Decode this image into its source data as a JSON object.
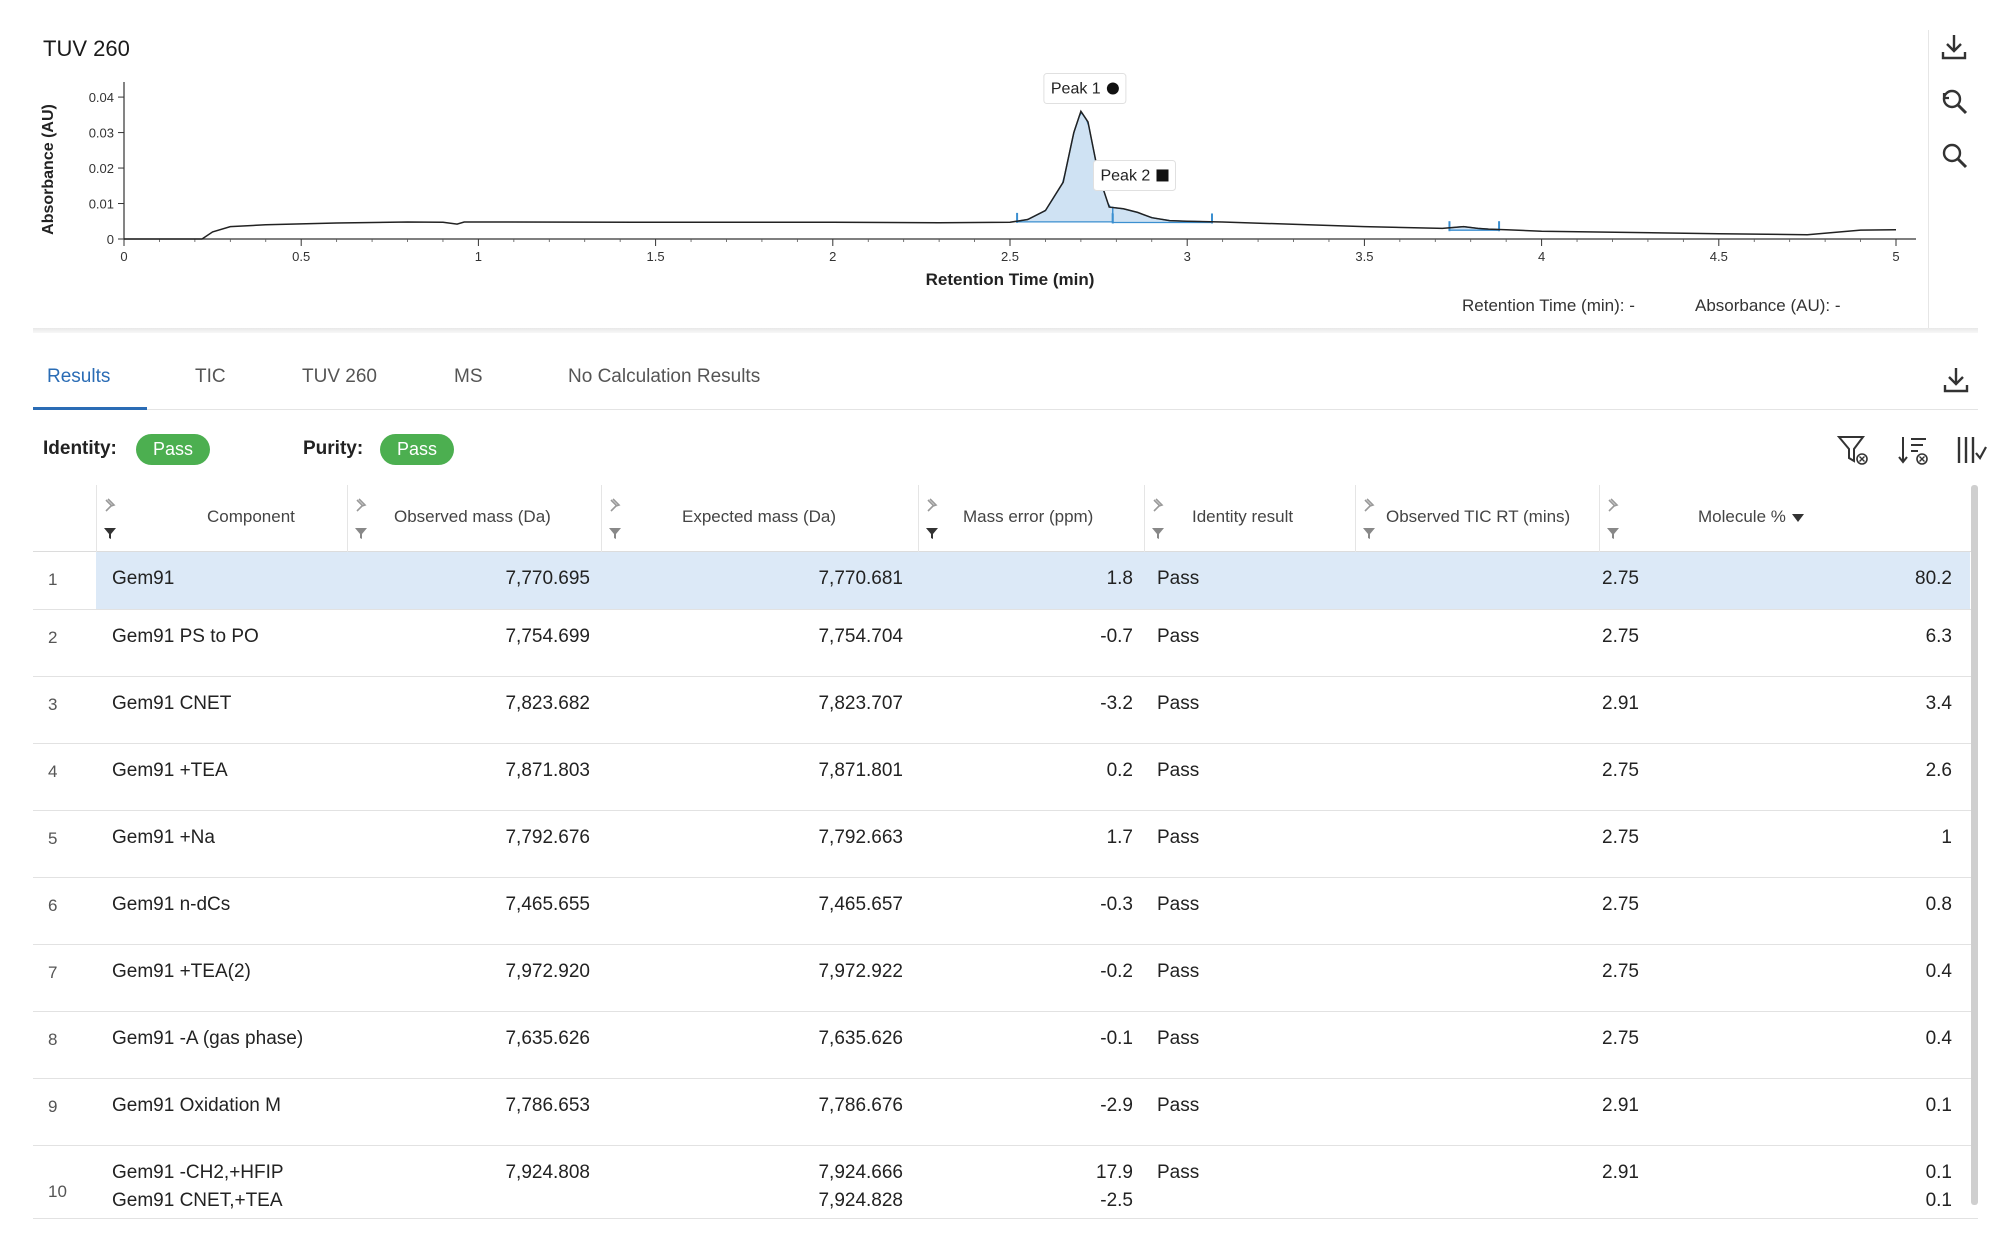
{
  "chart": {
    "title": "TUV 260",
    "readout": {
      "rt_label": "Retention Time (min):",
      "rt_value": "-",
      "abs_label": "Absorbance (AU):",
      "abs_value": "-"
    },
    "tools": [
      {
        "name": "download-icon"
      },
      {
        "name": "zoom-reset-icon"
      },
      {
        "name": "zoom-icon"
      }
    ]
  },
  "chart_data": {
    "type": "line",
    "title": "TUV 260",
    "xlabel": "Retention Time (min)",
    "ylabel": "Absorbance (AU)",
    "xlim": [
      0,
      5
    ],
    "ylim": [
      0,
      0.042
    ],
    "x_ticks": [
      0,
      0.5,
      1,
      1.5,
      2,
      2.5,
      3,
      3.5,
      4,
      4.5,
      5
    ],
    "x_tick_labels": [
      "0",
      "0.5",
      "1",
      "1.5",
      "2",
      "2.5",
      "3",
      "3.5",
      "4",
      "4.5",
      "5"
    ],
    "y_ticks": [
      0,
      0.01,
      0.02,
      0.03,
      0.04
    ],
    "y_tick_labels": [
      "0",
      "0.01",
      "0.02",
      "0.03",
      "0.04"
    ],
    "grid": false,
    "series": [
      {
        "x": [
          0,
          0.22,
          0.25,
          0.3,
          0.4,
          0.6,
          0.8,
          0.9,
          0.94,
          0.96,
          1.0,
          1.5,
          2.0,
          2.3,
          2.5,
          2.55,
          2.6,
          2.65,
          2.68,
          2.7,
          2.72,
          2.75,
          2.78,
          2.82,
          2.86,
          2.9,
          2.95,
          3.0,
          3.1,
          3.5,
          3.72,
          3.78,
          3.82,
          3.85,
          3.9,
          4.0,
          4.5,
          4.75,
          4.9,
          5.0
        ],
        "y": [
          0,
          0,
          0.002,
          0.0035,
          0.004,
          0.0045,
          0.0048,
          0.0047,
          0.0042,
          0.0048,
          0.0048,
          0.0047,
          0.0047,
          0.0046,
          0.0047,
          0.0055,
          0.008,
          0.016,
          0.03,
          0.036,
          0.033,
          0.018,
          0.009,
          0.0085,
          0.0075,
          0.006,
          0.0052,
          0.005,
          0.0048,
          0.0035,
          0.003,
          0.0035,
          0.003,
          0.0028,
          0.0026,
          0.0022,
          0.0015,
          0.0012,
          0.0025,
          0.0026
        ]
      }
    ],
    "peaks": [
      {
        "label": "Peak 1",
        "marker": "circle",
        "x": 2.7,
        "y": 0.036,
        "start": 2.52,
        "end": 2.79
      },
      {
        "label": "Peak 2",
        "marker": "square",
        "x": 2.83,
        "y": 0.0085,
        "start": 2.79,
        "end": 3.07
      },
      {
        "label": "",
        "marker": "",
        "x": 3.81,
        "y": 0.003,
        "start": 3.74,
        "end": 3.88
      }
    ]
  },
  "tabs": [
    {
      "label": "Results",
      "active": true
    },
    {
      "label": "TIC",
      "active": false
    },
    {
      "label": "TUV 260",
      "active": false
    },
    {
      "label": "MS",
      "active": false
    },
    {
      "label": "No Calculation Results",
      "active": false
    }
  ],
  "summary": {
    "identity_label": "Identity:",
    "identity_value": "Pass",
    "purity_label": "Purity:",
    "purity_value": "Pass"
  },
  "table": {
    "columns": [
      "Component",
      "Observed mass (Da)",
      "Expected mass (Da)",
      "Mass error (ppm)",
      "Identity result",
      "Observed TIC RT (mins)",
      "Molecule %"
    ],
    "sorted_column": "Molecule %",
    "rows": [
      {
        "n": "1",
        "component": [
          "Gem91"
        ],
        "observed": "7,770.695",
        "expected": [
          "7,770.681"
        ],
        "error": [
          "1.8"
        ],
        "identity": "Pass",
        "rt": "2.75",
        "molecule": [
          "80.2"
        ]
      },
      {
        "n": "2",
        "component": [
          "Gem91 PS to PO"
        ],
        "observed": "7,754.699",
        "expected": [
          "7,754.704"
        ],
        "error": [
          "-0.7"
        ],
        "identity": "Pass",
        "rt": "2.75",
        "molecule": [
          "6.3"
        ]
      },
      {
        "n": "3",
        "component": [
          "Gem91 CNET"
        ],
        "observed": "7,823.682",
        "expected": [
          "7,823.707"
        ],
        "error": [
          "-3.2"
        ],
        "identity": "Pass",
        "rt": "2.91",
        "molecule": [
          "3.4"
        ]
      },
      {
        "n": "4",
        "component": [
          "Gem91 +TEA"
        ],
        "observed": "7,871.803",
        "expected": [
          "7,871.801"
        ],
        "error": [
          "0.2"
        ],
        "identity": "Pass",
        "rt": "2.75",
        "molecule": [
          "2.6"
        ]
      },
      {
        "n": "5",
        "component": [
          "Gem91 +Na"
        ],
        "observed": "7,792.676",
        "expected": [
          "7,792.663"
        ],
        "error": [
          "1.7"
        ],
        "identity": "Pass",
        "rt": "2.75",
        "molecule": [
          "1"
        ]
      },
      {
        "n": "6",
        "component": [
          "Gem91 n-dCs"
        ],
        "observed": "7,465.655",
        "expected": [
          "7,465.657"
        ],
        "error": [
          "-0.3"
        ],
        "identity": "Pass",
        "rt": "2.75",
        "molecule": [
          "0.8"
        ]
      },
      {
        "n": "7",
        "component": [
          "Gem91 +TEA(2)"
        ],
        "observed": "7,972.920",
        "expected": [
          "7,972.922"
        ],
        "error": [
          "-0.2"
        ],
        "identity": "Pass",
        "rt": "2.75",
        "molecule": [
          "0.4"
        ]
      },
      {
        "n": "8",
        "component": [
          "Gem91 -A (gas phase)"
        ],
        "observed": "7,635.626",
        "expected": [
          "7,635.626"
        ],
        "error": [
          "-0.1"
        ],
        "identity": "Pass",
        "rt": "2.75",
        "molecule": [
          "0.4"
        ]
      },
      {
        "n": "9",
        "component": [
          "Gem91 Oxidation M"
        ],
        "observed": "7,786.653",
        "expected": [
          "7,786.676"
        ],
        "error": [
          "-2.9"
        ],
        "identity": "Pass",
        "rt": "2.91",
        "molecule": [
          "0.1"
        ]
      },
      {
        "n": "10",
        "component": [
          "Gem91 -CH2,+HFIP",
          "Gem91 CNET,+TEA"
        ],
        "observed": "7,924.808",
        "expected": [
          "7,924.666",
          "7,924.828"
        ],
        "error": [
          "17.9",
          "-2.5"
        ],
        "identity": "Pass",
        "rt": "2.91",
        "molecule": [
          "0.1",
          "0.1"
        ]
      }
    ]
  },
  "colors": {
    "accent": "#2a6cb5",
    "pass": "#4caf50",
    "selected_row": "#dce9f7",
    "peak_fill": "#cfe2f3",
    "peak_stroke": "#3b8fd0",
    "trace": "#222222"
  }
}
